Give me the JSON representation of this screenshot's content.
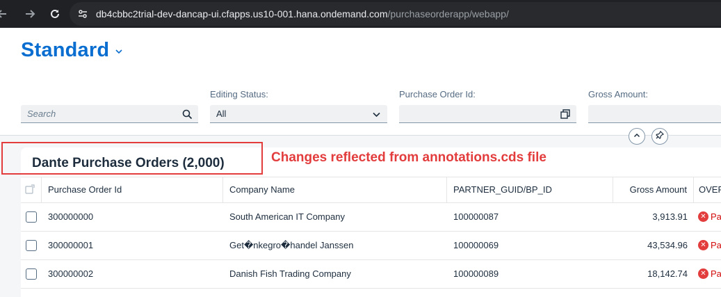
{
  "browser": {
    "url_host": "db4cbbc2trial-dev-dancap-ui.cfapps.us10-001.hana.ondemand.com",
    "url_path": "/purchaseorderapp/webapp/"
  },
  "header": {
    "variant_title": "Standard"
  },
  "filters": {
    "search_placeholder": "Search",
    "editing_status_label": "Editing Status:",
    "editing_status_value": "All",
    "purchase_order_id_label": "Purchase Order Id:",
    "gross_amount_label": "Gross Amount:"
  },
  "table": {
    "title": "Dante Purchase Orders (2,000)",
    "columns": [
      "Purchase Order Id",
      "Company Name",
      "PARTNER_GUID/BP_ID",
      "Gross Amount",
      "OVER"
    ],
    "rows": [
      {
        "po_id": "300000000",
        "company": "South American IT Company",
        "bp_id": "100000087",
        "gross": "3,913.91",
        "status": "Pa"
      },
      {
        "po_id": "300000001",
        "company": "Get�nkegro�handel Janssen",
        "bp_id": "100000069",
        "gross": "43,534.96",
        "status": "Pa"
      },
      {
        "po_id": "300000002",
        "company": "Danish Fish Trading Company",
        "bp_id": "100000089",
        "gross": "18,142.74",
        "status": "Pa"
      }
    ]
  },
  "annotation": {
    "text": "Changes reflected from annotations.cds file",
    "color": "#e23c3c"
  },
  "colors": {
    "brand": "#0a6ed1",
    "error": "#e23c3c"
  }
}
